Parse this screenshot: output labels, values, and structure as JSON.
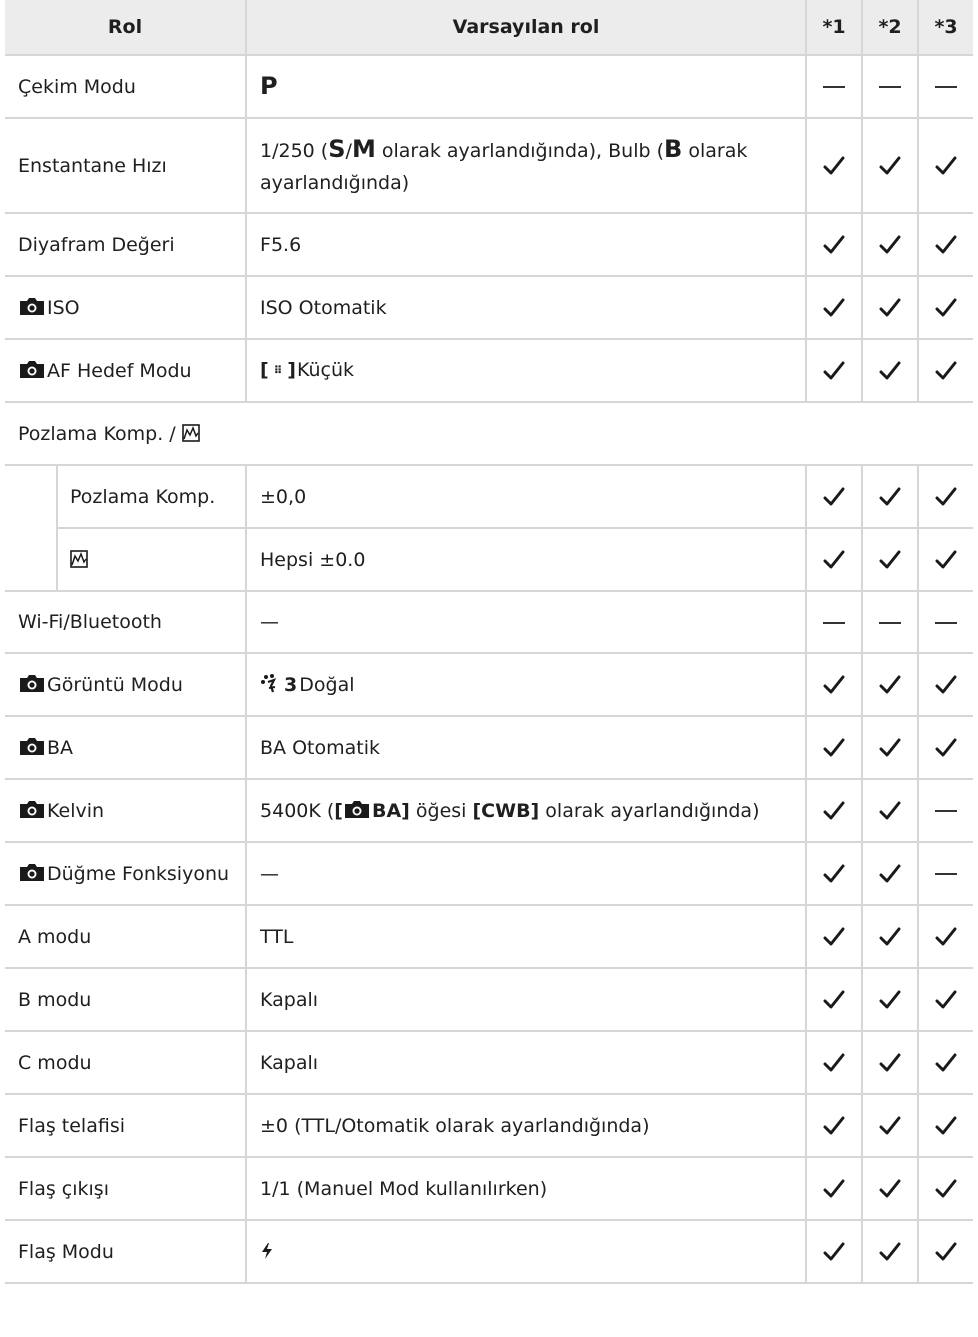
{
  "header": {
    "rol": "Rol",
    "default": "Varsayılan rol",
    "n1": "*1",
    "n2": "*2",
    "n3": "*3"
  },
  "rows": {
    "cekim": {
      "label": "Çekim Modu",
      "value": "P",
      "m1": "dash",
      "m2": "dash",
      "m3": "dash"
    },
    "enstantane": {
      "label": "Enstantane Hızı",
      "v1": "1/250 (",
      "vS": "S",
      "vSlash": "/",
      "vM": "M",
      "v2": " olarak ayarlandığında), Bulb (",
      "vB": "B",
      "v3": " olarak ayarlandığında)"
    },
    "diyafram": {
      "label": "Diyafram Değeri",
      "value": "F5.6"
    },
    "iso": {
      "label": "ISO",
      "value": "ISO Otomatik"
    },
    "af": {
      "label": "AF Hedef Modu",
      "bracket_open": "[",
      "dots": "⠿",
      "bracket_close": "]",
      "value": "Küçük"
    },
    "pozlama_group": {
      "label": "Pozlama Komp. / "
    },
    "pozlama": {
      "label": "Pozlama Komp.",
      "value": "±0,0"
    },
    "hist": {
      "value": "Hepsi ±0.0"
    },
    "wifi": {
      "label": "Wi-Fi/Bluetooth",
      "value": "—"
    },
    "goruntu": {
      "label": "Görüntü Modu",
      "num": "3",
      "value": "Doğal"
    },
    "ba": {
      "label": "BA",
      "value": "BA Otomatik"
    },
    "kelvin": {
      "label": "Kelvin",
      "v1": "5400K (",
      "b1": "[",
      "b2": "BA]",
      "v2": " öğesi ",
      "b3": "[CWB]",
      "v3": " olarak ayarlandığında)"
    },
    "dugme": {
      "label": "Düğme Fonksiyonu",
      "value": "—"
    },
    "amodu": {
      "label": "A modu",
      "value": "TTL"
    },
    "bmodu": {
      "label": "B modu",
      "value": "Kapalı"
    },
    "cmodu": {
      "label": "C modu",
      "value": "Kapalı"
    },
    "flas_tel": {
      "label": "Flaş telafisi",
      "value": "±0 (TTL/Otomatik olarak ayarlandığında)"
    },
    "flas_cikis": {
      "label": "Flaş çıkışı",
      "value": "1/1 (Manuel Mod kullanılırken)"
    },
    "flas_modu": {
      "label": "Flaş Modu"
    }
  },
  "icons": {
    "camera": "camera-icon",
    "check": "check-icon",
    "dash": "dash-icon",
    "histogram": "histogram-icon",
    "picture_mode": "picture-mode-icon",
    "flash": "flash-icon"
  }
}
